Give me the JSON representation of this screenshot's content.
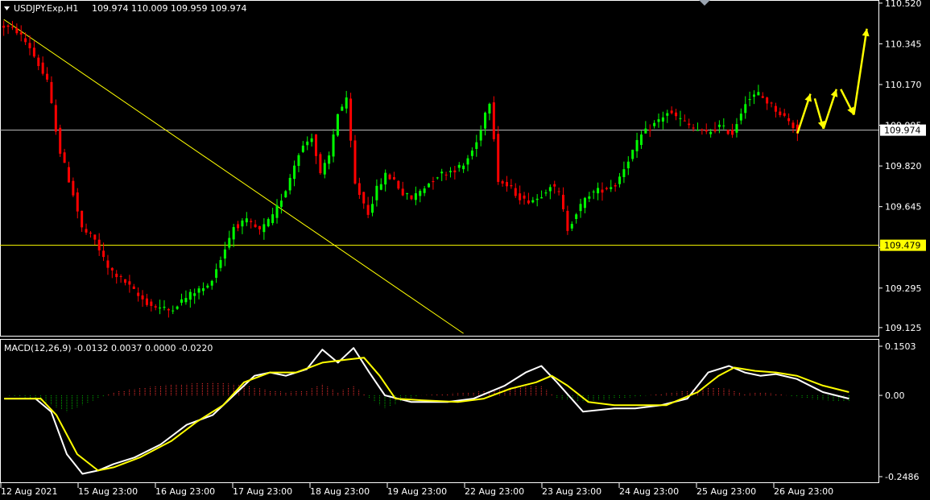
{
  "header": {
    "symbol_label": "USDJPY.Exp,H1",
    "ohlc": "109.974 110.009 109.959 109.974"
  },
  "indicator": {
    "label": "MACD(12,26,9) -0.0132 0.0037 0.0000 -0.0220"
  },
  "colors": {
    "background": "#000000",
    "bull_candle": "#00ff00",
    "bear_candle": "#ff0000",
    "trendline": "#ffff00",
    "support_line": "#ffff00",
    "price_line": "#c0c0c0",
    "arrows": "#ffff00",
    "macd_line": "#ffffff",
    "signal_line": "#ffff00",
    "hist_positive": "#ff3333",
    "hist_negative": "#00aa00"
  },
  "chart_data": [
    {
      "type": "candlestick",
      "ylim": [
        109.09,
        110.53
      ],
      "y_ticks": [
        "110.520",
        "110.345",
        "110.170",
        "109.995",
        "109.820",
        "109.645",
        "109.470",
        "109.295",
        "109.125"
      ],
      "x_ticks": [
        "12 Aug 2021",
        "15 Aug 23:00",
        "16 Aug 23:00",
        "17 Aug 23:00",
        "18 Aug 23:00",
        "19 Aug 23:00",
        "22 Aug 23:00",
        "23 Aug 23:00",
        "24 Aug 23:00",
        "25 Aug 23:00",
        "26 Aug 23:00"
      ],
      "current_price": 109.974,
      "current_price_label": "109.974",
      "support_level": 109.479,
      "support_label": "109.479",
      "close_path": [
        [
          0,
          110.42
        ],
        [
          3,
          110.4
        ],
        [
          6,
          110.33
        ],
        [
          10,
          110.18
        ],
        [
          13,
          109.88
        ],
        [
          16,
          109.7
        ],
        [
          18,
          109.55
        ],
        [
          21,
          109.5
        ],
        [
          24,
          109.38
        ],
        [
          28,
          109.32
        ],
        [
          31,
          109.26
        ],
        [
          34,
          109.22
        ],
        [
          38,
          109.2
        ],
        [
          41,
          109.24
        ],
        [
          44,
          109.28
        ],
        [
          47,
          109.3
        ],
        [
          50,
          109.42
        ],
        [
          53,
          109.56
        ],
        [
          56,
          109.58
        ],
        [
          59,
          109.54
        ],
        [
          62,
          109.6
        ],
        [
          65,
          109.72
        ],
        [
          68,
          109.88
        ],
        [
          71,
          109.95
        ],
        [
          73,
          109.78
        ],
        [
          75,
          109.86
        ],
        [
          77,
          110.05
        ],
        [
          79,
          110.1
        ],
        [
          81,
          109.74
        ],
        [
          84,
          109.62
        ],
        [
          86,
          109.72
        ],
        [
          88,
          109.78
        ],
        [
          90,
          109.76
        ],
        [
          92,
          109.7
        ],
        [
          94,
          109.68
        ],
        [
          97,
          109.73
        ],
        [
          100,
          109.78
        ],
        [
          103,
          109.8
        ],
        [
          106,
          109.82
        ],
        [
          109,
          109.92
        ],
        [
          111,
          110.05
        ],
        [
          112,
          110.1
        ],
        [
          113,
          109.95
        ],
        [
          114,
          109.76
        ],
        [
          117,
          109.72
        ],
        [
          120,
          109.67
        ],
        [
          123,
          109.68
        ],
        [
          126,
          109.74
        ],
        [
          128,
          109.7
        ],
        [
          130,
          109.55
        ],
        [
          132,
          109.62
        ],
        [
          135,
          109.7
        ],
        [
          138,
          109.72
        ],
        [
          141,
          109.74
        ],
        [
          144,
          109.85
        ],
        [
          147,
          109.95
        ],
        [
          150,
          110.0
        ],
        [
          153,
          110.05
        ],
        [
          156,
          110.02
        ],
        [
          159,
          109.98
        ],
        [
          162,
          109.96
        ],
        [
          165,
          109.99
        ],
        [
          168,
          109.96
        ],
        [
          171,
          110.1
        ],
        [
          174,
          110.13
        ],
        [
          177,
          110.08
        ],
        [
          180,
          110.03
        ],
        [
          183,
          109.97
        ]
      ],
      "trendline": {
        "start": [
          0,
          110.45
        ],
        "end": [
          106,
          109.1
        ]
      },
      "projection_arrows": [
        [
          [
            183,
            109.96
          ],
          [
            186,
            110.13
          ]
        ],
        [
          [
            187,
            110.11
          ],
          [
            189,
            109.98
          ]
        ],
        [
          [
            189,
            109.98
          ],
          [
            192,
            110.15
          ]
        ],
        [
          [
            193,
            110.15
          ],
          [
            196,
            110.04
          ]
        ],
        [
          [
            196,
            110.04
          ],
          [
            199,
            110.41
          ]
        ]
      ],
      "n_candles": 184,
      "n_slots": 202
    },
    {
      "type": "line",
      "title": "MACD(12,26,9)",
      "ylim": [
        -0.2486,
        0.1503
      ],
      "y_ticks": [
        "0.1503",
        "0.00",
        "-0.2486"
      ],
      "series": [
        {
          "key": "macd",
          "points": [
            [
              0,
              -0.01
            ],
            [
              6,
              -0.01
            ],
            [
              9,
              -0.05
            ],
            [
              12,
              -0.18
            ],
            [
              15,
              -0.24
            ],
            [
              18,
              -0.23
            ],
            [
              21,
              -0.21
            ],
            [
              25,
              -0.19
            ],
            [
              30,
              -0.15
            ],
            [
              35,
              -0.09
            ],
            [
              40,
              -0.06
            ],
            [
              44,
              0.0
            ],
            [
              48,
              0.06
            ],
            [
              51,
              0.07
            ],
            [
              54,
              0.06
            ],
            [
              58,
              0.08
            ],
            [
              61,
              0.14
            ],
            [
              64,
              0.1
            ],
            [
              67,
              0.145
            ],
            [
              70,
              0.07
            ],
            [
              73,
              0.0
            ],
            [
              78,
              -0.02
            ],
            [
              85,
              -0.02
            ],
            [
              90,
              -0.01
            ],
            [
              96,
              0.03
            ],
            [
              100,
              0.07
            ],
            [
              103,
              0.09
            ],
            [
              106,
              0.04
            ],
            [
              111,
              -0.05
            ],
            [
              117,
              -0.04
            ],
            [
              121,
              -0.04
            ],
            [
              126,
              -0.03
            ],
            [
              131,
              -0.01
            ],
            [
              135,
              0.07
            ],
            [
              139,
              0.09
            ],
            [
              142,
              0.07
            ],
            [
              145,
              0.06
            ],
            [
              148,
              0.065
            ],
            [
              152,
              0.05
            ],
            [
              157,
              0.01
            ],
            [
              162,
              -0.01
            ]
          ]
        },
        {
          "key": "signal",
          "points": [
            [
              0,
              -0.01
            ],
            [
              7,
              -0.01
            ],
            [
              10,
              -0.06
            ],
            [
              14,
              -0.18
            ],
            [
              18,
              -0.23
            ],
            [
              21,
              -0.22
            ],
            [
              26,
              -0.19
            ],
            [
              32,
              -0.14
            ],
            [
              37,
              -0.08
            ],
            [
              42,
              -0.03
            ],
            [
              46,
              0.04
            ],
            [
              51,
              0.07
            ],
            [
              56,
              0.07
            ],
            [
              61,
              0.1
            ],
            [
              66,
              0.11
            ],
            [
              69,
              0.115
            ],
            [
              72,
              0.06
            ],
            [
              75,
              -0.01
            ],
            [
              80,
              -0.015
            ],
            [
              87,
              -0.02
            ],
            [
              92,
              -0.01
            ],
            [
              97,
              0.02
            ],
            [
              102,
              0.04
            ],
            [
              105,
              0.06
            ],
            [
              108,
              0.03
            ],
            [
              112,
              -0.02
            ],
            [
              117,
              -0.03
            ],
            [
              122,
              -0.03
            ],
            [
              127,
              -0.03
            ],
            [
              133,
              0.01
            ],
            [
              137,
              0.06
            ],
            [
              140,
              0.085
            ],
            [
              144,
              0.075
            ],
            [
              148,
              0.07
            ],
            [
              152,
              0.06
            ],
            [
              157,
              0.03
            ],
            [
              162,
              0.01
            ]
          ]
        }
      ],
      "histogram": [
        [
          0,
          0.0
        ],
        [
          6,
          -0.01
        ],
        [
          9,
          -0.03
        ],
        [
          12,
          -0.05
        ],
        [
          15,
          -0.03
        ],
        [
          18,
          -0.01
        ],
        [
          21,
          0.01
        ],
        [
          25,
          0.02
        ],
        [
          30,
          0.03
        ],
        [
          35,
          0.035
        ],
        [
          40,
          0.04
        ],
        [
          44,
          0.035
        ],
        [
          48,
          0.025
        ],
        [
          51,
          0.015
        ],
        [
          54,
          0.01
        ],
        [
          58,
          0.015
        ],
        [
          61,
          0.035
        ],
        [
          64,
          0.01
        ],
        [
          67,
          0.03
        ],
        [
          70,
          -0.01
        ],
        [
          73,
          -0.04
        ],
        [
          76,
          -0.02
        ],
        [
          80,
          0.0
        ],
        [
          85,
          0.005
        ],
        [
          90,
          0.01
        ],
        [
          96,
          0.02
        ],
        [
          100,
          0.03
        ],
        [
          103,
          0.03
        ],
        [
          106,
          -0.01
        ],
        [
          111,
          -0.02
        ],
        [
          117,
          -0.01
        ],
        [
          121,
          -0.005
        ],
        [
          126,
          0.005
        ],
        [
          131,
          0.015
        ],
        [
          135,
          0.025
        ],
        [
          139,
          0.02
        ],
        [
          142,
          0.005
        ],
        [
          145,
          0.01
        ],
        [
          148,
          0.005
        ],
        [
          152,
          -0.005
        ],
        [
          157,
          -0.015
        ],
        [
          162,
          -0.02
        ]
      ],
      "n_slots": 168
    }
  ]
}
